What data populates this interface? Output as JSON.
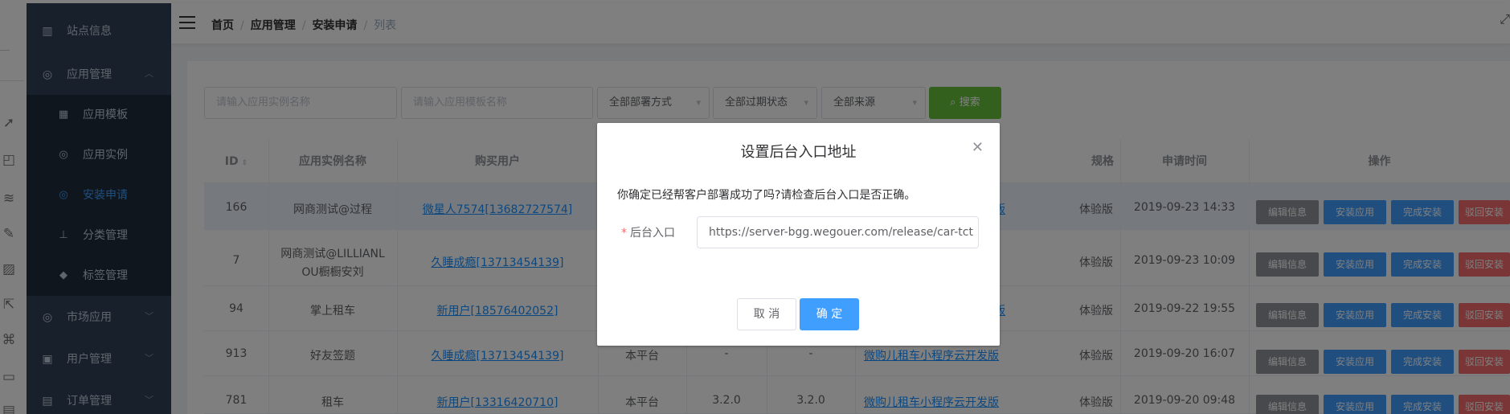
{
  "sidebar": {
    "items": [
      {
        "label": "站点信息",
        "icon": "site-icon"
      },
      {
        "label": "应用管理",
        "icon": "app-icon"
      },
      {
        "label": "市场应用",
        "icon": "market-icon"
      },
      {
        "label": "用户管理",
        "icon": "user-icon"
      },
      {
        "label": "订单管理",
        "icon": "order-icon"
      }
    ],
    "sub_items": [
      {
        "label": "应用模板",
        "icon": "grid-icon"
      },
      {
        "label": "应用实例",
        "icon": "instance-icon"
      },
      {
        "label": "安装申请",
        "icon": "install-icon",
        "active": true
      },
      {
        "label": "分类管理",
        "icon": "tree-icon"
      },
      {
        "label": "标签管理",
        "icon": "tag-icon"
      }
    ]
  },
  "breadcrumb": [
    "首页",
    "应用管理",
    "安装申请",
    "列表"
  ],
  "filters": {
    "instance_placeholder": "请输入应用实例名称",
    "template_placeholder": "请输入应用模板名称",
    "deploy_select": "全部部署方式",
    "expire_select": "全部过期状态",
    "source_select": "全部来源",
    "search_label": "搜索"
  },
  "table": {
    "headers": [
      "ID",
      "应用实例名称",
      "购买用户",
      "规格",
      "申请时间",
      "操作"
    ],
    "rows": [
      {
        "id": "166",
        "name": "网商测试@过程",
        "user": "微星人7574[13682727574]",
        "platform": "",
        "v1": "",
        "v2": "",
        "tpl": "版",
        "spec": "体验版",
        "time": "2019-09-23 14:33"
      },
      {
        "id": "7",
        "name": "网商测试@LILLIANL",
        "name2": "OU橱橱安刘",
        "user": "久睡成瘾[13713454139]",
        "platform": "",
        "v1": "",
        "v2": "",
        "tpl": "",
        "spec": "体验版",
        "time": "2019-09-23 10:09"
      },
      {
        "id": "94",
        "name": "掌上租车",
        "user": "新用户[18576402052]",
        "platform": "",
        "v1": "",
        "v2": "",
        "tpl": "版",
        "spec": "体验版",
        "time": "2019-09-22 19:55"
      },
      {
        "id": "913",
        "name": "好友签题",
        "user": "久睡成瘾[13713454139]",
        "platform": "本平台",
        "v1": "-",
        "v2": "-",
        "tpl": "微购儿租车小程序云开发版",
        "spec": "体验版",
        "time": "2019-09-20 16:07"
      },
      {
        "id": "781",
        "name": "租车",
        "user": "新用户[13316420710]",
        "platform": "本平台",
        "v1": "3.2.0",
        "v2": "3.2.0",
        "tpl": "微购儿租车小程序云开发版",
        "spec": "体验版",
        "time": "2019-09-20 09:48"
      }
    ],
    "actions": [
      "编辑信息",
      "安装应用",
      "完成安装",
      "驳回安装"
    ]
  },
  "dialog": {
    "title": "设置后台入口地址",
    "message": "你确定已经帮客户部署成功了吗?请检查后台入口是否正确。",
    "field_label": "后台入口",
    "field_value": "https://server-bgg.wegouer.com/release/car-tct",
    "cancel": "取 消",
    "confirm": "确 定"
  }
}
